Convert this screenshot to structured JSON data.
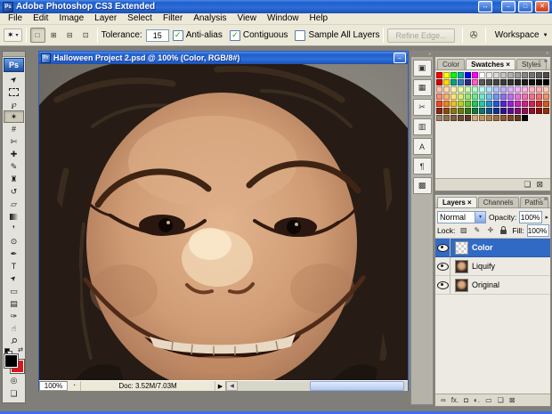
{
  "window": {
    "title": "Adobe Photoshop CS3 Extended",
    "app_logo": "Ps",
    "buttons": {
      "extra": "↔",
      "minimize": "–",
      "restore": "□",
      "close": "✕"
    }
  },
  "menu": {
    "items": [
      "File",
      "Edit",
      "Image",
      "Layer",
      "Select",
      "Filter",
      "Analysis",
      "View",
      "Window",
      "Help"
    ]
  },
  "options_bar": {
    "tool_icon": "✶",
    "dropdown_arrow": "▾",
    "selection_modes": [
      {
        "name": "new-selection-button",
        "glyph": "□",
        "pressed": true
      },
      {
        "name": "add-to-selection-button",
        "glyph": "⊞",
        "pressed": false
      },
      {
        "name": "subtract-from-selection-button",
        "glyph": "⊟",
        "pressed": false
      },
      {
        "name": "intersect-selection-button",
        "glyph": "⊡",
        "pressed": false
      }
    ],
    "tolerance_label": "Tolerance:",
    "tolerance_value": "15",
    "checkboxes": [
      {
        "label": "Anti-alias",
        "checked": true
      },
      {
        "label": "Contiguous",
        "checked": true
      },
      {
        "label": "Sample All Layers",
        "checked": false
      }
    ],
    "refine_edge_label": "Refine Edge...",
    "bridge_icon": "✇",
    "workspace_label": "Workspace",
    "workspace_arrow": "▼"
  },
  "toolbox": {
    "logo": "Ps",
    "tools": [
      {
        "name": "move-tool",
        "glyph": "➤",
        "selected": false
      },
      {
        "name": "rectangular-marquee-tool",
        "glyph": "",
        "selected": false
      },
      {
        "name": "lasso-tool",
        "glyph": "℘",
        "selected": false
      },
      {
        "name": "magic-wand-tool",
        "glyph": "✶",
        "selected": true
      },
      {
        "name": "crop-tool",
        "glyph": "#",
        "selected": false
      },
      {
        "name": "slice-tool",
        "glyph": "✄",
        "selected": false
      },
      {
        "name": "healing-brush-tool",
        "glyph": "✚",
        "selected": false
      },
      {
        "name": "brush-tool",
        "glyph": "✎",
        "selected": false
      },
      {
        "name": "clone-stamp-tool",
        "glyph": "♜",
        "selected": false
      },
      {
        "name": "history-brush-tool",
        "glyph": "↺",
        "selected": false
      },
      {
        "name": "eraser-tool",
        "glyph": "▱",
        "selected": false
      },
      {
        "name": "gradient-tool",
        "glyph": "",
        "selected": false
      },
      {
        "name": "blur-tool",
        "glyph": "❜",
        "selected": false
      },
      {
        "name": "dodge-tool",
        "glyph": "⊙",
        "selected": false
      },
      {
        "name": "pen-tool",
        "glyph": "✒",
        "selected": false
      },
      {
        "name": "type-tool",
        "glyph": "T",
        "selected": false
      },
      {
        "name": "path-selection-tool",
        "glyph": "➤",
        "selected": false
      },
      {
        "name": "shape-tool",
        "glyph": "▭",
        "selected": false
      },
      {
        "name": "notes-tool",
        "glyph": "▤",
        "selected": false
      },
      {
        "name": "eyedropper-tool",
        "glyph": "✑",
        "selected": false
      },
      {
        "name": "hand-tool",
        "glyph": "☝",
        "selected": false
      },
      {
        "name": "zoom-tool",
        "glyph": "⚲",
        "selected": false
      }
    ],
    "swap_icon": "⇄",
    "foreground_color": "#000000",
    "background_color": "#e01414",
    "quick_mask_icon": "◎",
    "screen_mode_icon": "❏"
  },
  "document": {
    "doc_icon": "Ps",
    "title": "Halloween Project 2.psd @ 100% (Color, RGB/8#)",
    "minimize_button": "–",
    "status": {
      "zoom": "100%",
      "timer_icon": "◔",
      "doc_size": "Doc: 3.52M/7.03M",
      "expand_arrow": "▶",
      "scroll_left_arrow": "◀"
    }
  },
  "dock": {
    "collapse_arrows": "»",
    "icons": [
      {
        "name": "history-icon",
        "glyph": "▣"
      },
      {
        "name": "navigator-icon",
        "glyph": "▦"
      },
      {
        "name": "tool-presets-icon",
        "glyph": "✂"
      },
      {
        "name": "histogram-icon",
        "glyph": "▥"
      },
      {
        "name": "character-icon",
        "glyph": "A"
      },
      {
        "name": "paragraph-icon",
        "glyph": "¶"
      },
      {
        "name": "clone-source-icon",
        "glyph": "▩"
      }
    ]
  },
  "panels_header_arrows": "»",
  "swatches_panel": {
    "tabs": [
      {
        "label": "Color",
        "active": false
      },
      {
        "label": "Swatches ×",
        "active": true
      },
      {
        "label": "Styles",
        "active": false
      }
    ],
    "minimize_icon": "−",
    "menu_icon": "≡",
    "colors": [
      "#ff0000",
      "#ffff00",
      "#00ff00",
      "#00b39c",
      "#0000ff",
      "#ff00ff",
      "#ffffff",
      "#ebebeb",
      "#d9d9d9",
      "#c4c4c4",
      "#b0b0b0",
      "#9c9c9c",
      "#888888",
      "#747474",
      "#606060",
      "#4c4c4c",
      "#d40000",
      "#ffd800",
      "#00a385",
      "#3a7abf",
      "#2a2a86",
      "#ff5fc0",
      "#585858",
      "#4e4e4e",
      "#444444",
      "#3a3a3a",
      "#303030",
      "#262626",
      "#1c1c1c",
      "#121212",
      "#090909",
      "#000000",
      "#ffc2b0",
      "#ffd9b0",
      "#fff2b0",
      "#e9ffb0",
      "#c4ffb0",
      "#b0ffc9",
      "#b0fff2",
      "#b0e4ff",
      "#b0c4ff",
      "#bdb0ff",
      "#d9b0ff",
      "#f2b0ff",
      "#ffb0e4",
      "#ffb0c4",
      "#ffb0b0",
      "#ffc9b0",
      "#ff8a70",
      "#ffb070",
      "#ffe270",
      "#d8f070",
      "#9ae870",
      "#70e894",
      "#70e8d0",
      "#70c4f0",
      "#7094f0",
      "#8a70f0",
      "#b870f0",
      "#e870e0",
      "#f070b0",
      "#f07090",
      "#f07070",
      "#f09070",
      "#f04722",
      "#f08022",
      "#f0c022",
      "#b8d022",
      "#62c822",
      "#22c85a",
      "#22c8a8",
      "#2290d0",
      "#2258d0",
      "#5822d0",
      "#9022d0",
      "#c822b8",
      "#d02280",
      "#d02258",
      "#d02222",
      "#d05a22",
      "#8c2310",
      "#8c4a10",
      "#8c7410",
      "#6a7c10",
      "#3a7410",
      "#107c3a",
      "#10746a",
      "#10548c",
      "#10348c",
      "#34108c",
      "#58108c",
      "#7c1074",
      "#8c1052",
      "#8c1034",
      "#8c1010",
      "#8c3410",
      "#9c8468",
      "#8c7050",
      "#7c5c40",
      "#6c4c34",
      "#5c3c28",
      "#d2a878",
      "#c09460",
      "#ae8050",
      "#9c6c40",
      "#8a5834",
      "#784628",
      "#663820",
      "#000000"
    ],
    "new_swatch_icon": "❏",
    "delete_swatch_icon": "⊠"
  },
  "layers_panel": {
    "tabs": [
      {
        "label": "Layers ×",
        "active": true
      },
      {
        "label": "Channels",
        "active": false
      },
      {
        "label": "Paths",
        "active": false
      }
    ],
    "minimize_icon": "−",
    "menu_icon": "≡",
    "blend_mode": "Normal",
    "combo_arrow": "▾",
    "opacity_label": "Opacity:",
    "opacity_value": "100%",
    "fill_label": "Fill:",
    "fill_value": "100%",
    "spinner_arrow": "▸",
    "lock_label": "Lock:",
    "lock_icons": [
      {
        "name": "lock-transparency-icon",
        "glyph": "▨",
        "lock_shape": false
      },
      {
        "name": "lock-pixels-icon",
        "glyph": "✎",
        "lock_shape": false
      },
      {
        "name": "lock-position-icon",
        "glyph": "✛",
        "lock_shape": false
      },
      {
        "name": "lock-all-icon",
        "glyph": "",
        "lock_shape": true
      }
    ],
    "layers": [
      {
        "label": "Color",
        "thumb": "checker",
        "selected": true
      },
      {
        "label": "Liquify",
        "thumb": "photo",
        "selected": false
      },
      {
        "label": "Original",
        "thumb": "photo",
        "selected": false
      }
    ],
    "bottom_icons": [
      {
        "name": "link-layers-icon",
        "glyph": "∞"
      },
      {
        "name": "layer-style-icon",
        "glyph": "fx."
      },
      {
        "name": "layer-mask-icon",
        "glyph": "◘"
      },
      {
        "name": "adjustment-layer-icon",
        "glyph": "◐."
      },
      {
        "name": "layer-group-icon",
        "glyph": "▭"
      },
      {
        "name": "new-layer-icon",
        "glyph": "❏"
      },
      {
        "name": "delete-layer-icon",
        "glyph": "⊠"
      }
    ]
  },
  "colors": {
    "selection_blue": "#316ac5",
    "titlebar_blue": "#2e6fd8",
    "workspace_gray": "#807e79",
    "panel_beige": "#ece9d8"
  }
}
